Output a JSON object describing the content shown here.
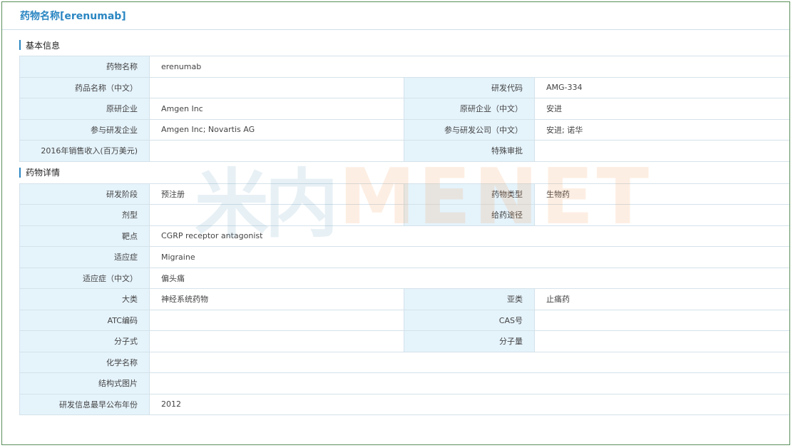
{
  "page": {
    "title": "药物名称[erenumab]"
  },
  "watermark": {
    "cn": "米内",
    "en": "MENET"
  },
  "basic": {
    "heading": "基本信息",
    "drug_name_label": "药物名称",
    "drug_name": "erenumab",
    "name_cn_label": "药品名称（中文）",
    "name_cn": "",
    "rd_code_label": "研发代码",
    "rd_code": "AMG-334",
    "originator_label": "原研企业",
    "originator": "Amgen Inc",
    "originator_cn_label": "原研企业（中文）",
    "originator_cn": "安进",
    "partners_label": "参与研发企业",
    "partners": "Amgen Inc; Novartis AG",
    "partners_cn_label": "参与研发公司（中文）",
    "partners_cn": "安进; 诺华",
    "sales_label": "2016年销售收入(百万美元)",
    "sales": "",
    "special_label": "特殊审批",
    "special": ""
  },
  "detail": {
    "heading": "药物详情",
    "stage_label": "研发阶段",
    "stage": "预注册",
    "type_label": "药物类型",
    "type": "生物药",
    "form_label": "剂型",
    "form": "",
    "route_label": "给药途径",
    "route": "",
    "target_label": "靶点",
    "target": "CGRP receptor antagonist",
    "indication_label": "适应症",
    "indication": "Migraine",
    "indication_cn_label": "适应症（中文）",
    "indication_cn": "偏头痛",
    "category_label": "大类",
    "category": "神经系统药物",
    "subcategory_label": "亚类",
    "subcategory": "止痛药",
    "atc_label": "ATC编码",
    "atc": "",
    "cas_label": "CAS号",
    "cas": "",
    "formula_label": "分子式",
    "formula": "",
    "mw_label": "分子量",
    "mw": "",
    "chem_name_label": "化学名称",
    "chem_name": "",
    "structure_label": "结构式图片",
    "structure": "",
    "year_label": "研发信息最早公布年份",
    "year": "2012"
  }
}
